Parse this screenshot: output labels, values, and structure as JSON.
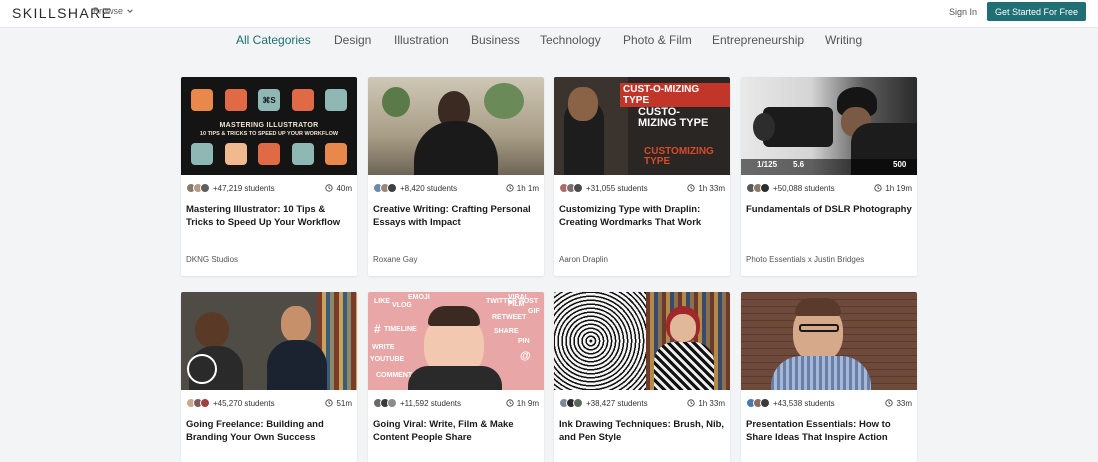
{
  "header": {
    "logo": "SKILLSHARE",
    "browse_label": "Browse",
    "signin_label": "Sign In",
    "cta_label": "Get Started For Free"
  },
  "categories": [
    "All Categories",
    "Design",
    "Illustration",
    "Business",
    "Technology",
    "Photo & Film",
    "Entrepreneurship",
    "Writing"
  ],
  "colors": {
    "accent": "#1f6f75",
    "background": "#f2f4f5"
  },
  "icons": {
    "browse": "chevron-down-icon",
    "duration": "clock-icon"
  },
  "cards": [
    {
      "students": "+47,219 students",
      "duration": "40m",
      "title": "Mastering Illustrator: 10 Tips & Tricks to Speed Up Your Workflow",
      "teacher": "DKNG Studios",
      "thumb_text": [
        "MASTERING ILLUSTRATOR",
        "10 TIPS & TRICKS TO SPEED UP YOUR WORKFLOW",
        "⌘S"
      ]
    },
    {
      "students": "+8,420 students",
      "duration": "1h 1m",
      "title": "Creative Writing: Crafting Personal Essays with Impact",
      "teacher": "Roxane Gay"
    },
    {
      "students": "+31,055 students",
      "duration": "1h 33m",
      "title": "Customizing Type with Draplin: Creating Wordmarks That Work",
      "teacher": "Aaron Draplin",
      "thumb_text": [
        "CUST-O-MIZING TYPE",
        "CUSTO-MIZING TYPE",
        "CUSTOMIZING TYPE"
      ]
    },
    {
      "students": "+50,088 students",
      "duration": "1h 19m",
      "title": "Fundamentals of DSLR Photography",
      "teacher": "Photo Essentials x Justin Bridges",
      "thumb_text": [
        "1/125",
        "5.6",
        "500"
      ]
    },
    {
      "students": "+45,270 students",
      "duration": "51m",
      "title": "Going Freelance: Building and Branding Your Own Success",
      "teacher": ""
    },
    {
      "students": "+11,592 students",
      "duration": "1h 9m",
      "title": "Going Viral: Write, Film & Make Content People Share",
      "teacher": "",
      "thumb_text": [
        "LIKE",
        "VLOG",
        "EMOJI",
        "#",
        "TIMELINE",
        "WRITE",
        "YOUTUBE",
        "COMMENT",
        "TWITTER POST",
        "RETWEET",
        "SHARE",
        "PIN",
        "VIRAL FILM",
        "GIF",
        "@"
      ]
    },
    {
      "students": "+38,427 students",
      "duration": "1h 33m",
      "title": "Ink Drawing Techniques: Brush, Nib, and Pen Style",
      "teacher": ""
    },
    {
      "students": "+43,538 students",
      "duration": "33m",
      "title": "Presentation Essentials: How to Share Ideas That Inspire Action",
      "teacher": ""
    }
  ]
}
